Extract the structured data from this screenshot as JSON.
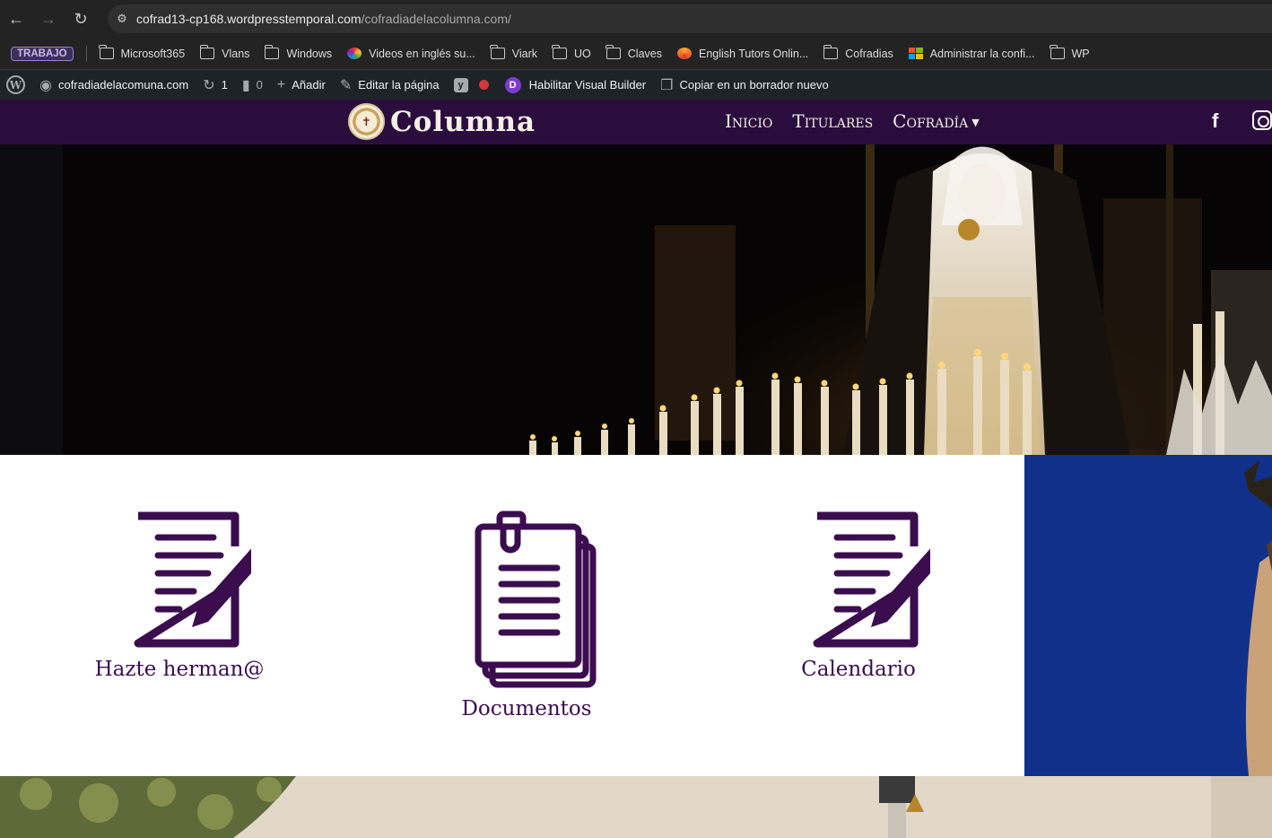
{
  "browser": {
    "url_host": "cofrad13-cp168.wordpresstemporal.com",
    "url_path": "/cofradiadelacolumna.com/",
    "nav_icons": [
      "back-arrow-icon",
      "forward-arrow-icon",
      "reload-icon",
      "site-settings-icon"
    ]
  },
  "bookmarks": {
    "tag": "TRABAJO",
    "items": [
      {
        "label": "Microsoft365",
        "icon": "folder-icon"
      },
      {
        "label": "Vlans",
        "icon": "folder-icon"
      },
      {
        "label": "Windows",
        "icon": "folder-icon"
      },
      {
        "label": "Videos en inglés su...",
        "icon": "colorful-site-icon"
      },
      {
        "label": "Viark",
        "icon": "folder-icon"
      },
      {
        "label": "UO",
        "icon": "folder-icon"
      },
      {
        "label": "Claves",
        "icon": "folder-icon"
      },
      {
        "label": "English Tutors Onlin...",
        "icon": "tutors-site-icon"
      },
      {
        "label": "Cofradias",
        "icon": "folder-icon"
      },
      {
        "label": "Administrar la confi...",
        "icon": "microsoft-icon"
      },
      {
        "label": "WP",
        "icon": "folder-icon"
      }
    ]
  },
  "wp_admin_bar": {
    "site_name": "cofradiadelacomuna.com",
    "updates_count": "1",
    "comments_count": "0",
    "add_label": "Añadir",
    "edit_label": "Editar la página",
    "visual_builder_label": "Habilitar Visual Builder",
    "copy_draft_label": "Copiar en un borrador nuevo"
  },
  "site": {
    "brand": "Columna",
    "menu": [
      "Inicio",
      "Titulares",
      "Cofradía"
    ],
    "social": [
      "facebook-icon",
      "instagram-icon"
    ]
  },
  "tiles": [
    {
      "label": "Hazte  herman@",
      "icon": "edit-document-icon"
    },
    {
      "label": "Documentos",
      "icon": "documents-stack-icon"
    },
    {
      "label": "Calendario",
      "icon": "edit-document-icon"
    }
  ],
  "colors": {
    "brand_purple": "#2a0d3d",
    "icon_purple": "#3b0d4f",
    "panel_blue": "#0f2e86"
  }
}
